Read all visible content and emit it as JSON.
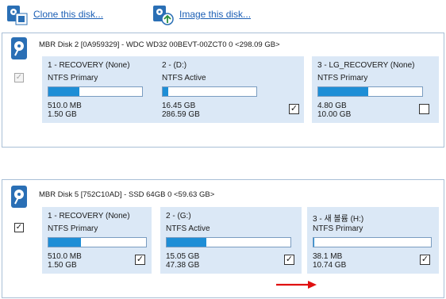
{
  "toolbar": {
    "clone_label": "Clone this disk...",
    "image_label": "Image this disk..."
  },
  "disks": [
    {
      "title": "MBR Disk 2 [0A959329] - WDC WD32 00BEVT-00ZCT0   0  <298.09 GB>",
      "selected": true,
      "partitions": [
        {
          "name": "1 - RECOVERY (None)",
          "fs": "NTFS Primary",
          "used": "510.0 MB",
          "total": "1.50 GB",
          "fill": 0.33,
          "checked": false
        },
        {
          "name": "2 -  (D:)",
          "fs": "NTFS Active",
          "used": "16.45 GB",
          "total": "286.59 GB",
          "fill": 0.06,
          "checked": true
        },
        {
          "name": "3 - LG_RECOVERY (None)",
          "fs": "NTFS Primary",
          "used": "4.80 GB",
          "total": "10.00 GB",
          "fill": 0.48,
          "checked": false
        }
      ]
    },
    {
      "title": "MBR Disk 5 [752C10AD] - SSD 64GB                        0  <59.63 GB>",
      "selected": true,
      "partitions": [
        {
          "name": "1 - RECOVERY (None)",
          "fs": "NTFS Primary",
          "used": "510.0 MB",
          "total": "1.50 GB",
          "fill": 0.33,
          "checked": true
        },
        {
          "name": "2 -  (G:)",
          "fs": "NTFS Active",
          "used": "15.05 GB",
          "total": "47.38 GB",
          "fill": 0.32,
          "checked": true
        },
        {
          "name": "3 - 새 볼륨 (H:)",
          "fs": "NTFS Primary",
          "used": "38.1 MB",
          "total": "10.74 GB",
          "fill": 0.004,
          "checked": true
        }
      ]
    }
  ],
  "colors": {
    "accent": "#1e8ed6",
    "partition_bg": "#dbe8f6",
    "border": "#a9bfd6",
    "link": "#1c5fb5",
    "arrow": "#e01010"
  },
  "icons": {
    "clone": "clone-disk-icon",
    "image": "image-disk-icon",
    "disk": "hard-disk-icon",
    "arrow": "right-arrow-icon"
  }
}
